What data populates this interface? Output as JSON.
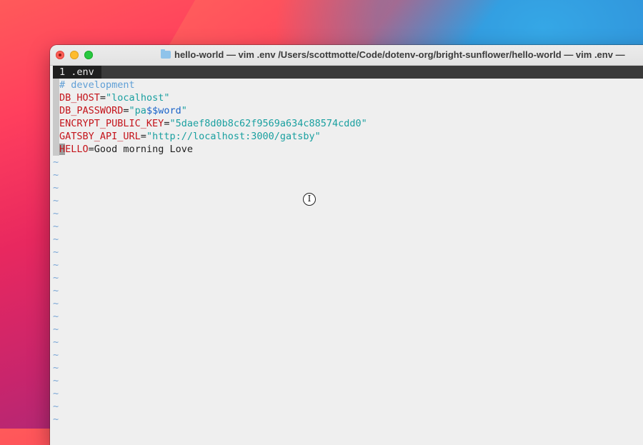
{
  "window": {
    "title": "hello-world — vim .env /Users/scottmotte/Code/dotenv-org/bright-sunflower/hello-world — vim .env —",
    "folder_icon": "folder-icon"
  },
  "vim": {
    "tab_label": "1 .env",
    "lines": {
      "comment": "# development",
      "db_host_key": "DB_HOST",
      "db_host_value": "\"localhost\"",
      "db_password_key": "DB_PASSWORD",
      "db_password_value_open": "\"pa",
      "db_password_value_var": "$$word",
      "db_password_value_close": "\"",
      "encrypt_key": "ENCRYPT_PUBLIC_KEY",
      "encrypt_value": "\"5daef8d0b8c62f9569a634c88574cdd0\"",
      "gatsby_key": "GATSBY_API_URL",
      "gatsby_value": "\"http://localhost:3000/gatsby\"",
      "hello_key_first": "H",
      "hello_key_rest": "ELLO",
      "hello_value": "Good morning Love",
      "equals": "="
    },
    "empty_line_marker": "~",
    "empty_line_count": 21
  },
  "colors": {
    "key": "#c4141b",
    "string": "#1aa0a0",
    "comment": "#5f9fd6",
    "tilde": "#7aa7d6"
  },
  "cursor_icon": "ibeam-cursor-icon"
}
